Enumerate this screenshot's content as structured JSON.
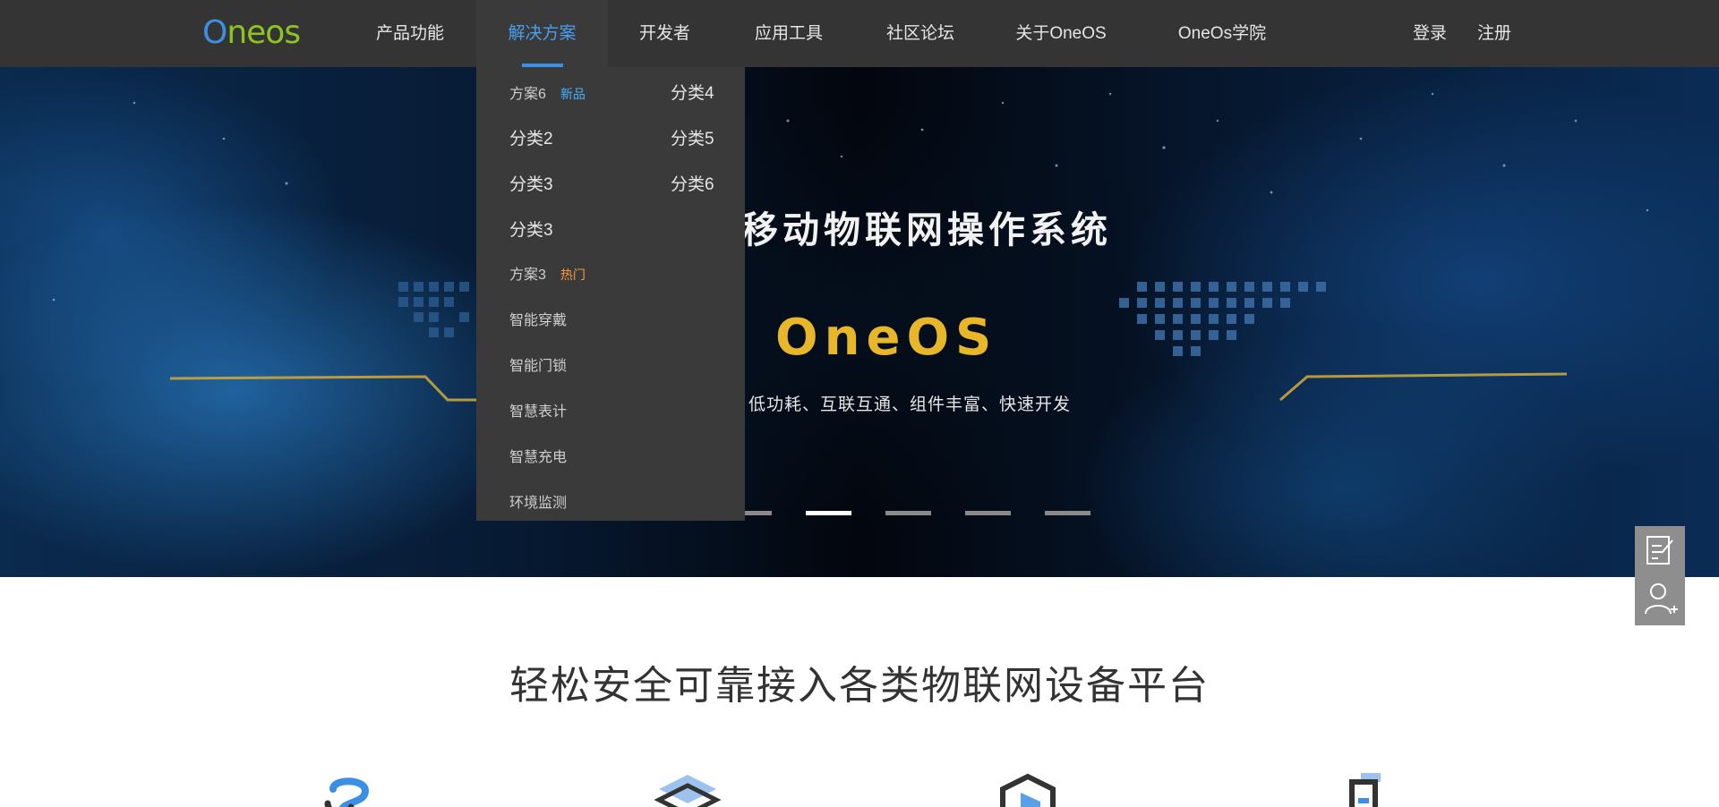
{
  "brand": {
    "logo_first": "O",
    "logo_rest": "neos"
  },
  "nav": {
    "items": [
      {
        "label": "产品功能"
      },
      {
        "label": "解决方案"
      },
      {
        "label": "开发者"
      },
      {
        "label": "应用工具"
      },
      {
        "label": "社区论坛"
      },
      {
        "label": "关于OneOS"
      },
      {
        "label": "OneOs学院"
      }
    ],
    "active_index": 1,
    "login": "登录",
    "register": "注册"
  },
  "dropdown": {
    "left_column": [
      {
        "label": "方案6",
        "tag": "新品",
        "tag_type": "new",
        "style": "small"
      },
      {
        "label": "分类2",
        "style": "normal"
      },
      {
        "label": "分类3",
        "style": "normal"
      },
      {
        "label": "分类3",
        "style": "normal"
      },
      {
        "label": "方案3",
        "tag": "热门",
        "tag_type": "hot",
        "style": "small"
      },
      {
        "label": "智能穿戴",
        "style": "small"
      },
      {
        "label": "智能门锁",
        "style": "small"
      },
      {
        "label": "智慧表计",
        "style": "small"
      },
      {
        "label": "智慧充电",
        "style": "small"
      },
      {
        "label": "环境监测",
        "style": "small"
      }
    ],
    "right_column": [
      {
        "label": "分类4"
      },
      {
        "label": "分类5"
      },
      {
        "label": "分类6"
      }
    ]
  },
  "banner": {
    "title": "移动物联网操作系统",
    "brand": "OneOS",
    "subtitle": "低功耗、互联互通、组件丰富、快速开发",
    "slide_count": 6,
    "active_slide": 2
  },
  "side_tools": {
    "icons": [
      "edit-note-icon",
      "add-user-icon"
    ]
  },
  "section": {
    "title": "轻松安全可靠接入各类物联网设备平台"
  },
  "colors": {
    "nav_bg": "#343434",
    "dropdown_bg": "#3a3a3a",
    "accent_blue": "#3b8fe4",
    "logo_green": "#8fc31f",
    "brand_gold": "#e8b629",
    "tag_new": "#4ab0ff",
    "tag_hot": "#ff9a3c"
  }
}
